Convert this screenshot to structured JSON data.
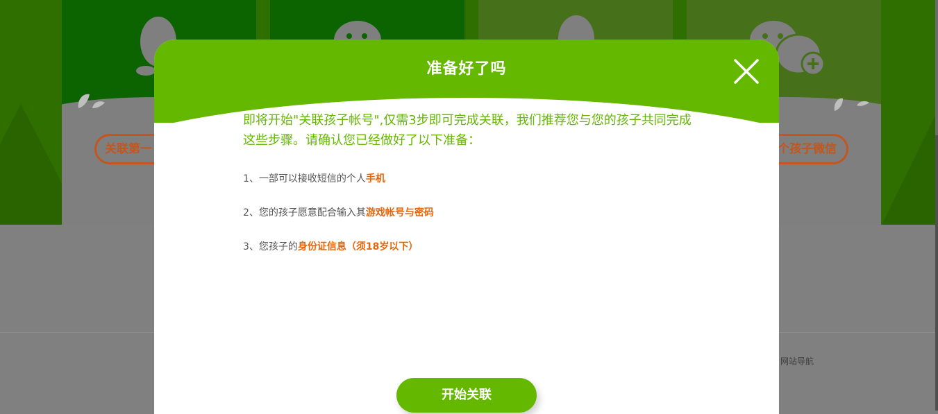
{
  "background": {
    "cards": [
      {
        "icon": "qq-penguin-icon",
        "button_label": "关联第一"
      },
      {
        "icon": "wechat-icon"
      },
      {
        "icon": "qq-penguin-icon"
      },
      {
        "icon": "wechat-add-icon",
        "button_label": "个孩子微信"
      }
    ],
    "footer_link": "网站导航"
  },
  "modal": {
    "title": "准备好了吗",
    "close_icon": "close-icon",
    "intro": "即将开始\"关联孩子帐号\",仅需3步即可完成关联，我们推荐您与您的孩子共同完成这些步骤。请确认您已经做好了以下准备：",
    "steps": [
      {
        "prefix": "1、一部可以接收短信的个人",
        "highlight": "手机"
      },
      {
        "prefix": "2、您的孩子愿意配合输入其",
        "highlight": "游戏帐号与密码"
      },
      {
        "prefix": "3、您孩子的",
        "highlight": "身份证信息（须18岁以下）"
      }
    ],
    "start_button": "开始关联"
  },
  "colors": {
    "brand_green": "#64b800",
    "highlight_orange": "#e8650a",
    "overlay_button_orange": "#c2561e"
  }
}
